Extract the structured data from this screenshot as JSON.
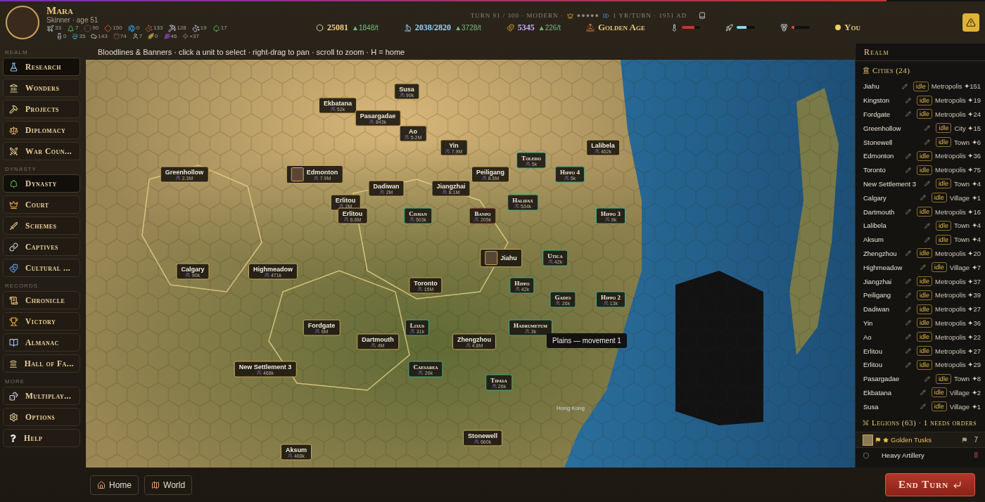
{
  "top_progress": {
    "level": 0.9
  },
  "leader": {
    "name": "Mara",
    "subtitle": "Skinner · age 51"
  },
  "resources_row_1": [
    {
      "kind": "plane",
      "amount": "33"
    },
    {
      "kind": "pine",
      "amount": "7"
    },
    {
      "kind": "stone",
      "amount": "90"
    },
    {
      "kind": "gem",
      "amount": "150"
    },
    {
      "kind": "fish",
      "amount": "0"
    },
    {
      "kind": "paw",
      "amount": "133"
    },
    {
      "kind": "pickaxe",
      "amount": "128"
    },
    {
      "kind": "pawgray",
      "amount": "19"
    },
    {
      "kind": "tree",
      "amount": "17"
    }
  ],
  "resources_row_2": [
    {
      "kind": "bottle",
      "amount": "0"
    },
    {
      "kind": "bowl",
      "amount": "35"
    },
    {
      "kind": "cloud",
      "amount": "143"
    },
    {
      "kind": "barrel",
      "amount": "74"
    },
    {
      "kind": "person",
      "amount": "7"
    },
    {
      "kind": "wheat",
      "amount": "0"
    },
    {
      "kind": "grape",
      "amount": "46"
    },
    {
      "kind": "sparkle",
      "amount": "×37"
    }
  ],
  "turn_info": {
    "turn": "TURN 91 / 300 · MODERN ·",
    "rating": "●●●●●",
    "speed": "1 YR/TURN · 1951 AD"
  },
  "stats": [
    {
      "kind": "gold",
      "value": "25081",
      "rate": "▲1848/t"
    },
    {
      "kind": "science",
      "value": "2038/2820",
      "rate": "▲3728/t"
    },
    {
      "kind": "culture",
      "value": "5345",
      "rate": "▲226/t"
    }
  ],
  "golden_age": "Golden Age",
  "meters": [
    {
      "kind": "thermometer",
      "level": 0.7,
      "color": "#c0392b"
    },
    {
      "kind": "rocket",
      "level": 0.55,
      "color": "#8fd3f0"
    },
    {
      "kind": "medal",
      "level": 0.15,
      "color": "#d9503a"
    }
  ],
  "player": "You",
  "hint": "Bloodlines & Banners · click a unit to select · right-drag to pan · scroll to zoom · H = home",
  "sidebar": [
    {
      "section": "REALM",
      "items": [
        {
          "label": "Research",
          "kind": "flask",
          "selected": true
        },
        {
          "label": "Wonders",
          "kind": "landmark",
          "selected": false
        },
        {
          "label": "Projects",
          "kind": "hammer",
          "selected": false
        },
        {
          "label": "Diplomacy",
          "kind": "scale",
          "selected": false
        },
        {
          "label": "War Coun...",
          "kind": "swords",
          "selected": false
        }
      ]
    },
    {
      "section": "DYNASTY",
      "items": [
        {
          "label": "Dynasty",
          "kind": "tree",
          "selected": true
        },
        {
          "label": "Court",
          "kind": "crown",
          "selected": false
        },
        {
          "label": "Schemes",
          "kind": "sword",
          "selected": false
        },
        {
          "label": "Captives",
          "kind": "link",
          "selected": false
        },
        {
          "label": "Cultural ...",
          "kind": "masks",
          "selected": false
        }
      ]
    },
    {
      "section": "RECORDS",
      "items": [
        {
          "label": "Chronicle",
          "kind": "scroll",
          "selected": false
        },
        {
          "label": "Victory",
          "kind": "trophy",
          "selected": false
        },
        {
          "label": "Almanac",
          "kind": "book",
          "selected": false
        },
        {
          "label": "Hall of Fa...",
          "kind": "landmark",
          "selected": false
        }
      ]
    },
    {
      "section": "MORE",
      "items": [
        {
          "label": "Multiplay...",
          "kind": "dice",
          "selected": false
        },
        {
          "label": "Options",
          "kind": "settings",
          "selected": false
        },
        {
          "label": "Help",
          "kind": "help",
          "selected": false
        }
      ]
    }
  ],
  "map": {
    "cities": [
      {
        "name": "Susa",
        "population": "90k",
        "kind": "own",
        "portrait": false
      },
      {
        "name": "Ekbatana",
        "population": "52k",
        "kind": "own",
        "portrait": false
      },
      {
        "name": "Pasargadae",
        "population": "843k",
        "kind": "own",
        "portrait": false
      },
      {
        "name": "Ao",
        "population": "5.2M",
        "kind": "own",
        "portrait": false
      },
      {
        "name": "Yin",
        "population": "7.9M",
        "kind": "own",
        "portrait": false
      },
      {
        "name": "Lalibela",
        "population": "462k",
        "kind": "own",
        "portrait": false
      },
      {
        "name": "Toledo",
        "population": "5k",
        "kind": "foreign",
        "portrait": false
      },
      {
        "name": "Greenhollow",
        "population": "2.3M",
        "kind": "own",
        "portrait": false
      },
      {
        "name": "Edmonton",
        "population": "7.9M",
        "kind": "own",
        "portrait": true
      },
      {
        "name": "Peiligang",
        "population": "8.5M",
        "kind": "own",
        "portrait": false
      },
      {
        "name": "Hippo 4",
        "population": "5k",
        "kind": "foreign",
        "portrait": false
      },
      {
        "name": "Dadiwan",
        "population": "2M",
        "kind": "own",
        "portrait": false
      },
      {
        "name": "Jiangzhai",
        "population": "8.1M",
        "kind": "own",
        "portrait": false
      },
      {
        "name": "Erlitou",
        "population": "2M",
        "kind": "own",
        "portrait": false
      },
      {
        "name": "Halifax",
        "population": "534k",
        "kind": "foreign",
        "portrait": false
      },
      {
        "name": "Erlitou",
        "population": "6.6M",
        "kind": "own",
        "portrait": false
      },
      {
        "name": "Cishan",
        "population": "503k",
        "kind": "foreign",
        "portrait": false
      },
      {
        "name": "Banpo",
        "population": "205k",
        "kind": "hostile",
        "portrait": false
      },
      {
        "name": "Hippo 3",
        "population": "9k",
        "kind": "foreign",
        "portrait": false
      },
      {
        "name": "Jiahu",
        "kind": "own",
        "portrait": true
      },
      {
        "name": "Utica",
        "population": "42k",
        "kind": "foreign",
        "portrait": false
      },
      {
        "name": "Calgary",
        "population": "90k",
        "kind": "own",
        "portrait": false
      },
      {
        "name": "Highmeadow",
        "population": "471k",
        "kind": "own",
        "portrait": false
      },
      {
        "name": "Toronto",
        "population": "15M",
        "kind": "own",
        "portrait": false
      },
      {
        "name": "Hippo",
        "population": "42k",
        "kind": "foreign",
        "portrait": false
      },
      {
        "name": "Gades",
        "population": "26k",
        "kind": "foreign",
        "portrait": false
      },
      {
        "name": "Hippo 2",
        "population": "13k",
        "kind": "foreign",
        "portrait": false
      },
      {
        "name": "Fordgate",
        "population": "6M",
        "kind": "own",
        "portrait": false
      },
      {
        "name": "Lixus",
        "population": "31k",
        "kind": "foreign",
        "portrait": false
      },
      {
        "name": "Hadrumetum",
        "population": "3k",
        "kind": "foreign",
        "portrait": false
      },
      {
        "name": "Dartmouth",
        "population": "4M",
        "kind": "own",
        "portrait": false
      },
      {
        "name": "Zhengzhou",
        "population": "4.8M",
        "kind": "own",
        "portrait": false
      },
      {
        "name": "New Settlement 3",
        "population": "468k",
        "kind": "own",
        "portrait": false
      },
      {
        "name": "Caesarea",
        "population": "26k",
        "kind": "foreign",
        "portrait": false
      },
      {
        "name": "Tipasa",
        "population": "26k",
        "kind": "foreign",
        "portrait": false
      },
      {
        "name": "Stonewell",
        "population": "660k",
        "kind": "own",
        "portrait": false
      },
      {
        "name": "Aksum",
        "population": "468k",
        "kind": "own",
        "portrait": false
      }
    ],
    "places": [
      {
        "name": "Hong Kong"
      }
    ],
    "tooltip": "Plains — movement 1"
  },
  "realm_panel": {
    "title": "Realm",
    "cities_heading": "Cities (24)",
    "cities": [
      {
        "name": "Jiahu",
        "status": "idle",
        "type": "Metropolis ✦151"
      },
      {
        "name": "Kingston",
        "status": "idle",
        "type": "Metropolis ✦19"
      },
      {
        "name": "Fordgate",
        "status": "idle",
        "type": "Metropolis ✦24"
      },
      {
        "name": "Greenhollow",
        "status": "idle",
        "type": "City ✦15"
      },
      {
        "name": "Stonewell",
        "status": "idle",
        "type": "Town ✦6"
      },
      {
        "name": "Edmonton",
        "status": "idle",
        "type": "Metropolis ✦36"
      },
      {
        "name": "Toronto",
        "status": "idle",
        "type": "Metropolis ✦75"
      },
      {
        "name": "New Settlement 3",
        "status": "idle",
        "type": "Town ✦4"
      },
      {
        "name": "Calgary",
        "status": "idle",
        "type": "Village ✦1"
      },
      {
        "name": "Dartmouth",
        "status": "idle",
        "type": "Metropolis ✦16"
      },
      {
        "name": "Lalibela",
        "status": "idle",
        "type": "Town ✦4"
      },
      {
        "name": "Aksum",
        "status": "idle",
        "type": "Town ✦4"
      },
      {
        "name": "Zhengzhou",
        "status": "idle",
        "type": "Metropolis ✦20"
      },
      {
        "name": "Highmeadow",
        "status": "idle",
        "type": "Village ✦7"
      },
      {
        "name": "Jiangzhai",
        "status": "idle",
        "type": "Metropolis ✦37"
      },
      {
        "name": "Peiligang",
        "status": "idle",
        "type": "Metropolis ✦39"
      },
      {
        "name": "Dadiwan",
        "status": "idle",
        "type": "Metropolis ✦27"
      },
      {
        "name": "Yin",
        "status": "idle",
        "type": "Metropolis ✦36"
      },
      {
        "name": "Ao",
        "status": "idle",
        "type": "Metropolis ✦22"
      },
      {
        "name": "Erlitou",
        "status": "idle",
        "type": "Metropolis ✦27"
      },
      {
        "name": "Erlitou",
        "status": "idle",
        "type": "Metropolis ✦29"
      },
      {
        "name": "Pasargadae",
        "status": "idle",
        "type": "Town ✦8"
      },
      {
        "name": "Ekbatana",
        "status": "idle",
        "type": "Village ✦2"
      },
      {
        "name": "Susa",
        "status": "idle",
        "type": "Village ✦1"
      }
    ],
    "legions_heading": "Legions (63) · 1 needs orders",
    "legions": [
      {
        "name": "Golden Tusks",
        "count": "7",
        "highlighted": true,
        "needs_orders": false
      },
      {
        "name": "Heavy Artillery",
        "count": "8",
        "highlighted": false,
        "needs_orders": true
      }
    ]
  },
  "bottom": {
    "buttons": [
      {
        "label": "Home",
        "kind": "home"
      },
      {
        "label": "World",
        "kind": "map"
      }
    ],
    "end_turn": "End Turn"
  }
}
